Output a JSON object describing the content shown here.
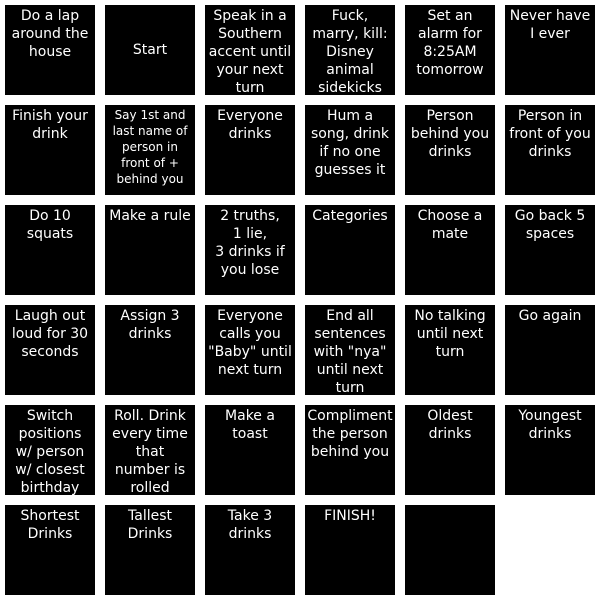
{
  "board": {
    "tiles": [
      {
        "text": "Do a lap\naround the\nhouse"
      },
      {
        "text": "Start"
      },
      {
        "text": "Speak in a\nSouthern\naccent until\nyour next\nturn"
      },
      {
        "text": "Fuck,\nmarry, kill:\nDisney\nanimal\nsidekicks"
      },
      {
        "text": "Set an\nalarm for\n8:25AM\ntomorrow"
      },
      {
        "text": "Never have\nI ever"
      },
      {
        "text": "Finish your\ndrink"
      },
      {
        "text": "Say 1st and\nlast name of\nperson in\nfront of +\nbehind you"
      },
      {
        "text": "Everyone\ndrinks"
      },
      {
        "text": "Hum a\nsong, drink\nif no one\nguesses it"
      },
      {
        "text": "Person\nbehind you\ndrinks"
      },
      {
        "text": "Person in\nfront of you\ndrinks"
      },
      {
        "text": "Do 10\nsquats"
      },
      {
        "text": "Make a rule"
      },
      {
        "text": "2 truths,\n1 lie,\n3 drinks if\nyou lose"
      },
      {
        "text": "Categories"
      },
      {
        "text": "Choose a\nmate"
      },
      {
        "text": "Go back 5\nspaces"
      },
      {
        "text": "Laugh out\nloud for 30\nseconds"
      },
      {
        "text": "Assign 3\ndrinks"
      },
      {
        "text": "Everyone\ncalls you\n\"Baby\" until\nnext turn"
      },
      {
        "text": "End all\nsentences\nwith \"nya\"\nuntil next\nturn"
      },
      {
        "text": "No talking\nuntil next\nturn"
      },
      {
        "text": "Go again"
      },
      {
        "text": "Switch\npositions\nw/ person\nw/ closest\nbirthday"
      },
      {
        "text": "Roll. Drink\nevery time\nthat\nnumber is\nrolled"
      },
      {
        "text": "Make a\ntoast"
      },
      {
        "text": "Compliment\nthe person\nbehind you"
      },
      {
        "text": "Oldest\ndrinks"
      },
      {
        "text": "Youngest\ndrinks"
      },
      {
        "text": "Shortest\nDrinks"
      },
      {
        "text": "Tallest\nDrinks"
      },
      {
        "text": "Take 3\ndrinks"
      },
      {
        "text": "FINISH!"
      },
      {
        "text": ""
      }
    ]
  }
}
